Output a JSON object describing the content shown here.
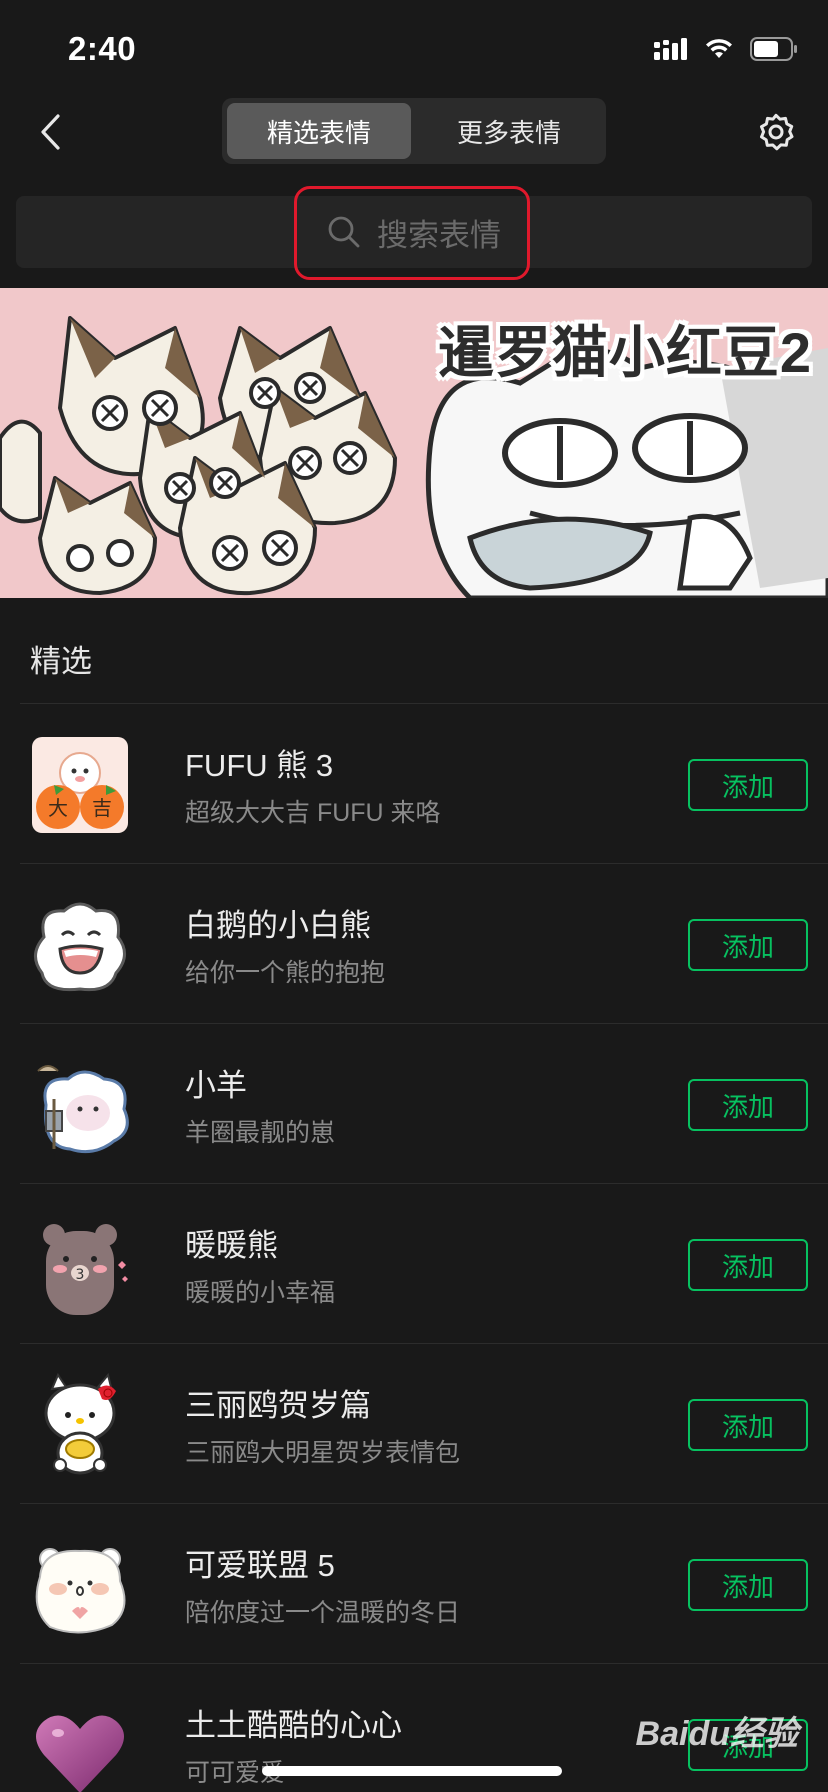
{
  "status_bar": {
    "time": "2:40"
  },
  "nav": {
    "tabs": [
      {
        "label": "精选表情",
        "active": true
      },
      {
        "label": "更多表情",
        "active": false
      }
    ]
  },
  "search": {
    "placeholder": "搜索表情"
  },
  "banner": {
    "title": "暹罗猫小红豆2"
  },
  "section": {
    "title": "精选"
  },
  "stickers": [
    {
      "name": "FUFU 熊 3",
      "desc": "超级大大吉 FUFU 来咯",
      "action": "添加"
    },
    {
      "name": "白鹅的小白熊",
      "desc": "给你一个熊的抱抱",
      "action": "添加"
    },
    {
      "name": "小羊",
      "desc": "羊圈最靓的崽",
      "action": "添加"
    },
    {
      "name": "暖暖熊",
      "desc": "暖暖的小幸福",
      "action": "添加"
    },
    {
      "name": "三丽鸥贺岁篇",
      "desc": "三丽鸥大明星贺岁表情包",
      "action": "添加"
    },
    {
      "name": "可爱联盟 5",
      "desc": "陪你度过一个温暖的冬日",
      "action": "添加"
    },
    {
      "name": "土土酷酷的心心",
      "desc": "可可爱爱",
      "action": "添加"
    }
  ],
  "watermark": "Baidu经验",
  "colors": {
    "accent": "#07c160",
    "background": "#191919",
    "highlight": "#e0192c"
  }
}
